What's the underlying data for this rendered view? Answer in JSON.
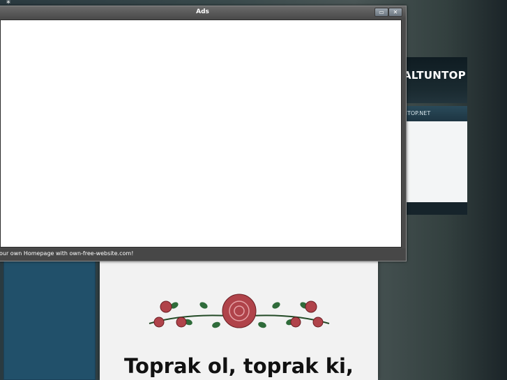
{
  "website": {
    "title": "ALTUNTOP",
    "nav_text": "NTOP.NET",
    "poem_line": "Toprak ol, toprak ki,"
  },
  "ads_window": {
    "title": "Ads",
    "status_text": "our own Homepage with own-free-website.com!",
    "maximize_glyph": "▭",
    "close_glyph": "✕"
  },
  "cursor": "⁎",
  "colors": {
    "left_column": "#21506a",
    "rose": "#b0434a",
    "leaf": "#2f6b3a"
  }
}
